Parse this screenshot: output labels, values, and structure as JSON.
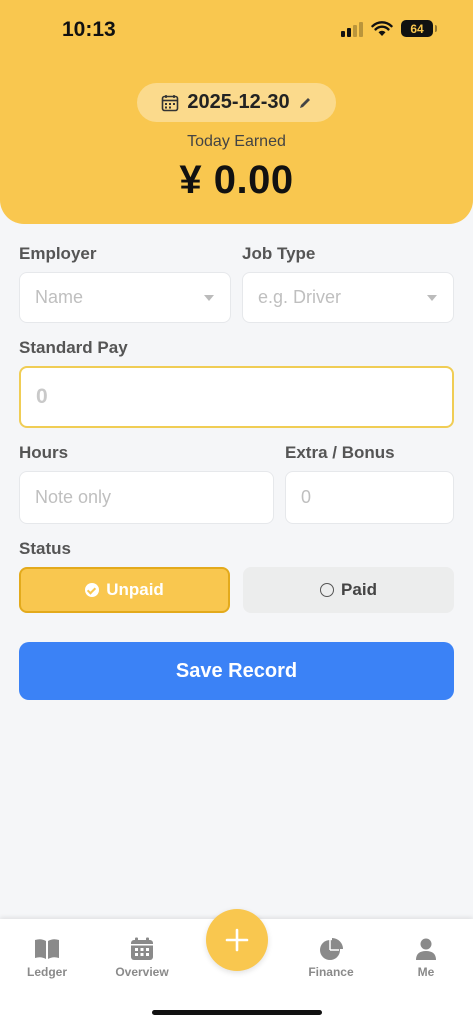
{
  "status_bar": {
    "time": "10:13",
    "battery": "64"
  },
  "header": {
    "date": "2025-12-30",
    "earned_label": "Today Earned",
    "earned_value": "¥ 0.00"
  },
  "form": {
    "employer": {
      "label": "Employer",
      "placeholder": "Name"
    },
    "job_type": {
      "label": "Job Type",
      "placeholder": "e.g. Driver"
    },
    "standard_pay": {
      "label": "Standard Pay",
      "placeholder": "0"
    },
    "hours": {
      "label": "Hours",
      "placeholder": "Note only"
    },
    "extra_bonus": {
      "label": "Extra / Bonus",
      "placeholder": "0"
    },
    "status": {
      "label": "Status",
      "unpaid_label": "Unpaid",
      "paid_label": "Paid",
      "selected": "Unpaid"
    },
    "save_label": "Save Record"
  },
  "bottom_nav": {
    "items": [
      {
        "label": "Ledger",
        "icon": "book-icon"
      },
      {
        "label": "Overview",
        "icon": "calendar-icon"
      },
      {
        "label": "Finance",
        "icon": "pie-chart-icon"
      },
      {
        "label": "Me",
        "icon": "person-icon"
      }
    ],
    "fab_icon": "plus-icon"
  },
  "colors": {
    "accent": "#f9c74f",
    "primary": "#3b82f6",
    "background": "#f5f6f8"
  }
}
